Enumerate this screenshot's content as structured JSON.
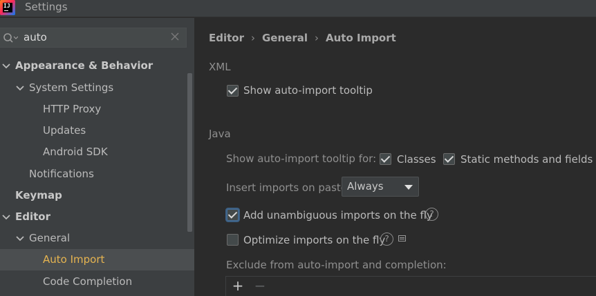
{
  "window": {
    "title": "Settings",
    "app_icon": "intellij-idea-icon"
  },
  "search": {
    "value": "auto",
    "icon": "search-icon",
    "clear_icon": "close-icon"
  },
  "tree": {
    "items": [
      {
        "label": "Appearance & Behavior",
        "expanded": true,
        "bold": true
      },
      {
        "label": "System Settings",
        "expanded": true
      },
      {
        "label": "HTTP Proxy"
      },
      {
        "label": "Updates"
      },
      {
        "label": "Android SDK"
      },
      {
        "label": "Notifications"
      },
      {
        "label": "Keymap",
        "bold": true
      },
      {
        "label": "Editor",
        "expanded": true,
        "bold": true
      },
      {
        "label": "General",
        "expanded": true
      },
      {
        "label": "Auto Import",
        "selected": true
      },
      {
        "label": "Code Completion"
      }
    ]
  },
  "breadcrumb": {
    "items": [
      "Editor",
      "General",
      "Auto Import"
    ],
    "separator": "›"
  },
  "xml_section": {
    "label": "XML",
    "show_tooltip": {
      "label": "Show auto-import tooltip",
      "checked": true
    }
  },
  "java_section": {
    "label": "Java",
    "tooltip_for_label": "Show auto-import tooltip for:",
    "classes": {
      "label": "Classes",
      "checked": true
    },
    "static_methods": {
      "label": "Static methods and fields",
      "checked": true
    },
    "insert_on_paste": {
      "label": "Insert imports on paste:",
      "value": "Always"
    },
    "add_unambiguous": {
      "label": "Add unambiguous imports on the fly",
      "checked": true,
      "help": "?"
    },
    "optimize_imports": {
      "label": "Optimize imports on the fly",
      "checked": false,
      "help": "?"
    },
    "exclude_label": "Exclude from auto-import and completion:",
    "toolbar": {
      "add": "+",
      "remove": "−"
    }
  },
  "colors": {
    "selected_tree_text": "#e6b450",
    "focus_ring": "#3d6185",
    "background": "#2b2b2b",
    "sidebar": "#3c3f41"
  }
}
